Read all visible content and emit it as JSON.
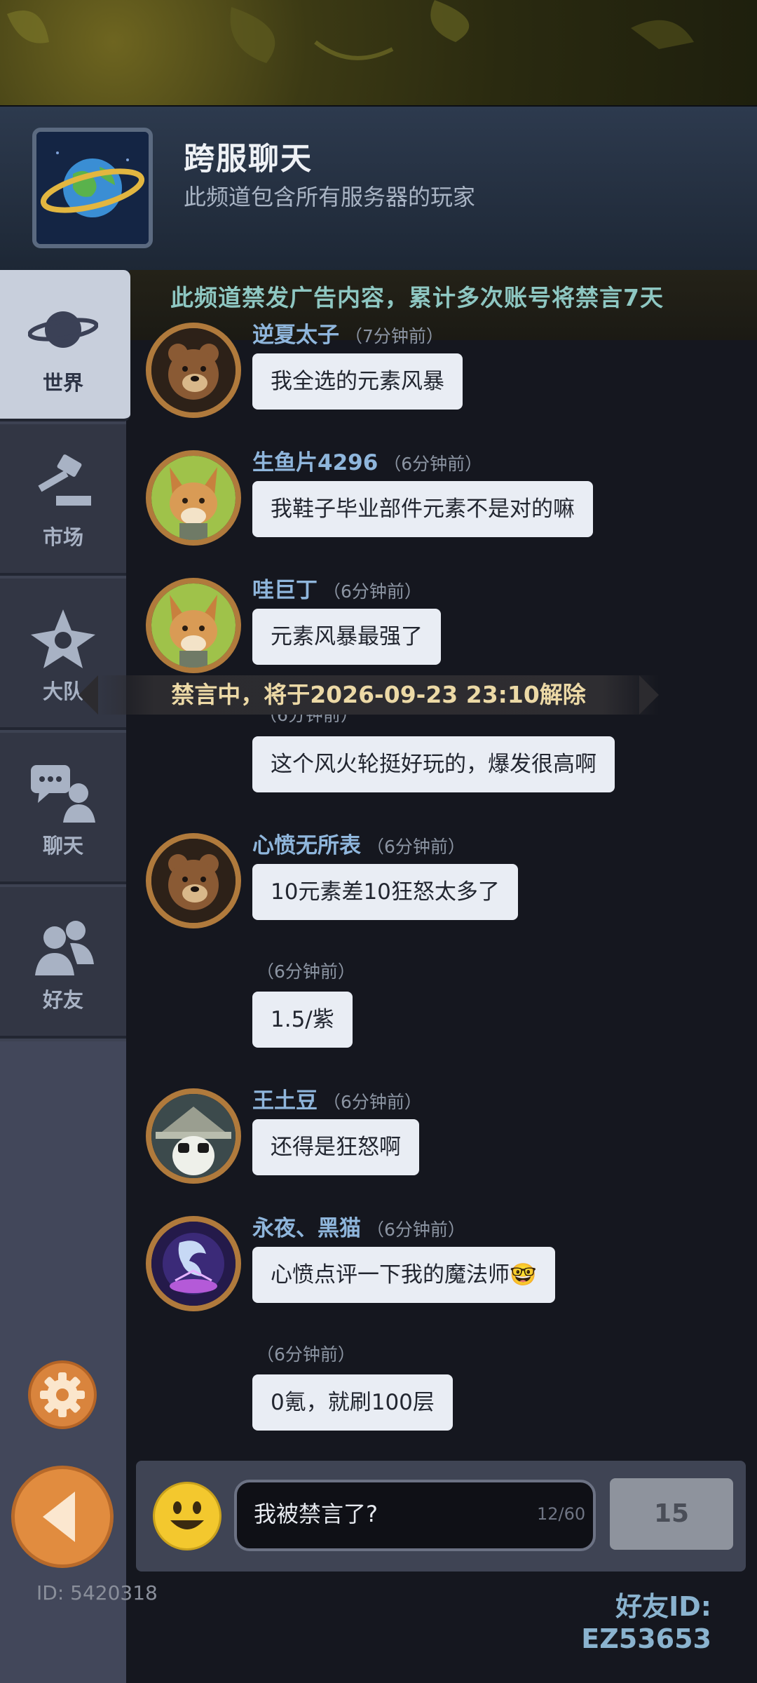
{
  "header": {
    "title": "跨服聊天",
    "subtitle": "此频道包含所有服务器的玩家"
  },
  "notice": "此频道禁发广告内容，累计多次账号将禁言7天",
  "sidebar": {
    "items": [
      {
        "label": "世界",
        "icon": "planet-icon",
        "active": true
      },
      {
        "label": "市场",
        "icon": "gavel-icon",
        "active": false
      },
      {
        "label": "大队",
        "icon": "guild-emblem-icon",
        "active": false
      },
      {
        "label": "聊天",
        "icon": "chat-icon",
        "active": false
      },
      {
        "label": "好友",
        "icon": "friends-icon",
        "active": false
      }
    ],
    "user_id": "ID: 5420318"
  },
  "messages": [
    {
      "name": "逆夏太子",
      "time": "（7分钟前）",
      "text": "我全选的元素风暴",
      "avatar": "bear-avatar"
    },
    {
      "name": "生鱼片4296",
      "time": "（6分钟前）",
      "text": "我鞋子毕业部件元素不是对的嘛",
      "avatar": "fox-avatar"
    },
    {
      "name": "哇巨丁",
      "time": "（6分钟前）",
      "text": "元素风暴最强了",
      "avatar": "fox-avatar"
    },
    {
      "name": "",
      "time": "（6分钟前）",
      "text": "这个风火轮挺好玩的，爆发很高啊",
      "avatar": ""
    },
    {
      "name": "心愤无所表",
      "time": "（6分钟前）",
      "text": "10元素差10狂怒太多了",
      "avatar": "bear-avatar"
    },
    {
      "name": "",
      "time": "（6分钟前）",
      "text": "1.5/紫",
      "avatar": ""
    },
    {
      "name": "王土豆",
      "time": "（6分钟前）",
      "text": "还得是狂怒啊",
      "avatar": "wizard-avatar"
    },
    {
      "name": "永夜、黑猫",
      "time": "（6分钟前）",
      "text": "心愤点评一下我的魔法师🤓",
      "avatar": "mage-avatar"
    },
    {
      "name": "",
      "time": "（6分钟前）",
      "text": "0氪，就刷100层",
      "avatar": ""
    }
  ],
  "ban_banner": "禁言中，将于2026-09-23 23:10解除",
  "input": {
    "value": "我被禁言了?",
    "counter": "12/60",
    "send_label": "15"
  },
  "friend_id": "好友ID: EZ53653",
  "colors": {
    "accent_orange": "#e18c3f",
    "name_blue": "#8fb6dc",
    "notice_teal": "#8ec7c2",
    "ban_text": "#ecd9a6"
  }
}
